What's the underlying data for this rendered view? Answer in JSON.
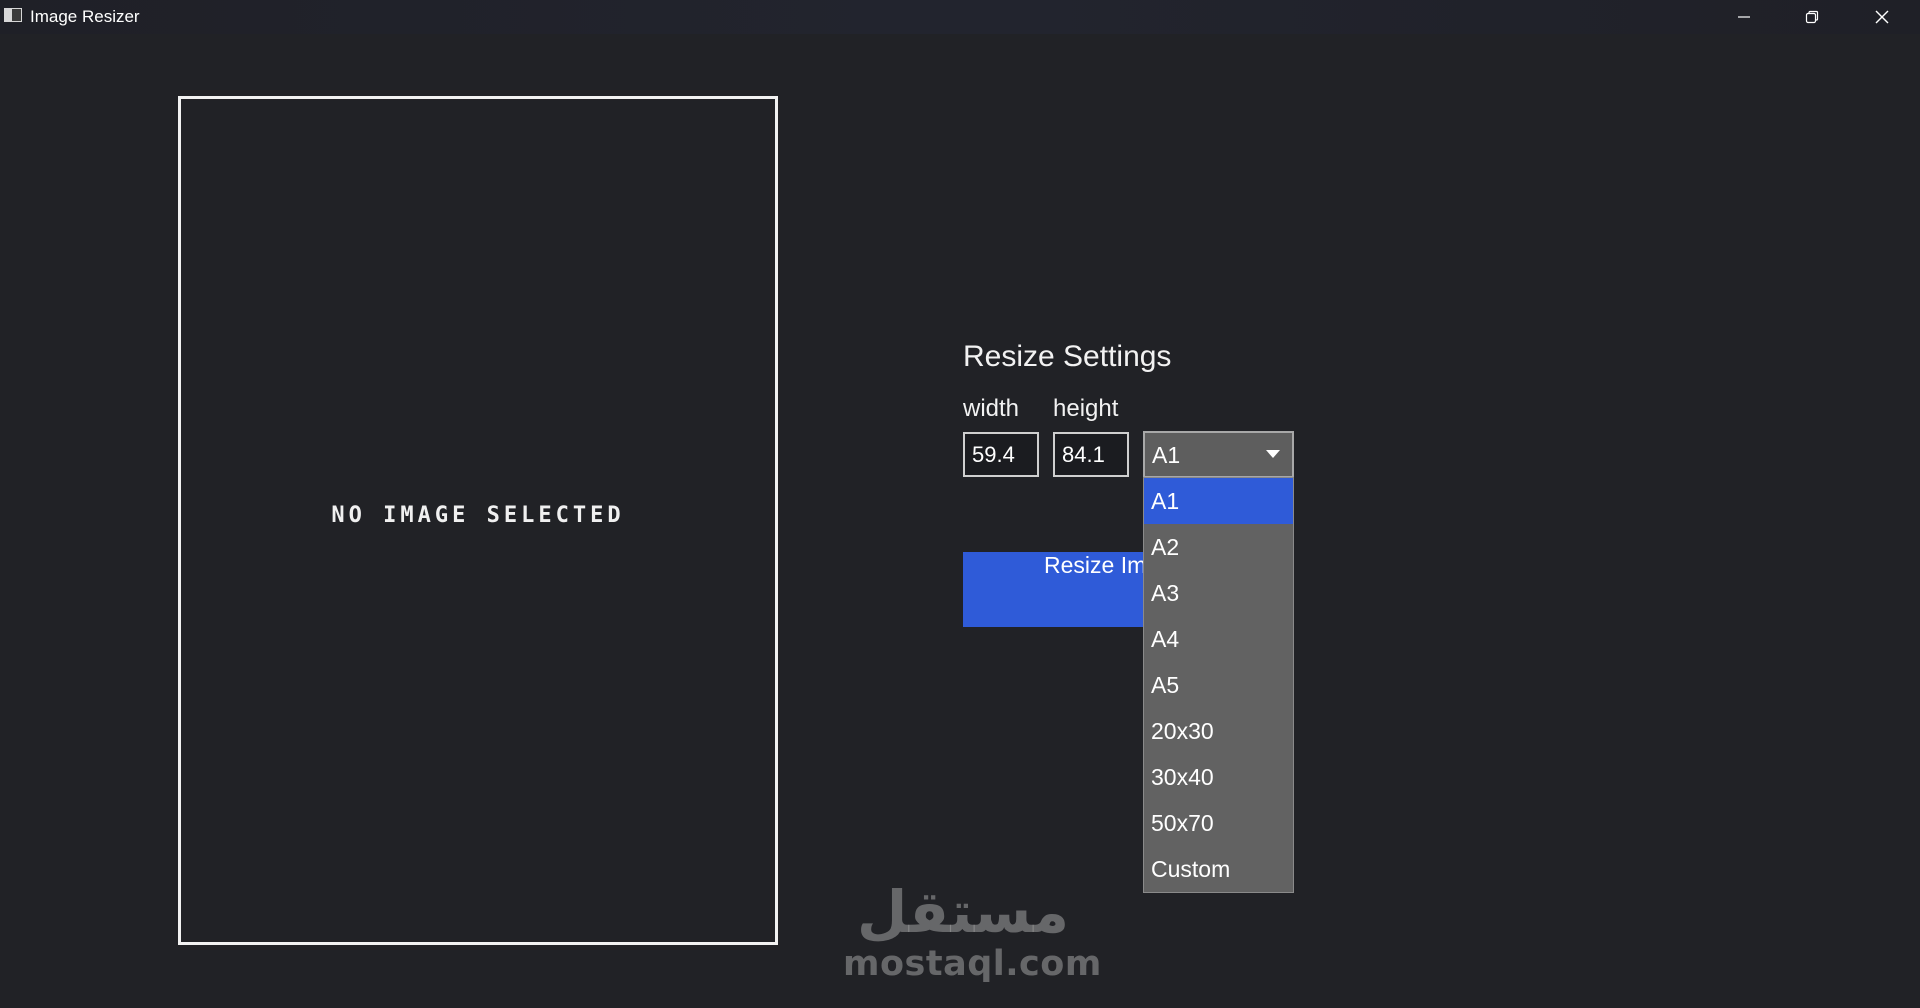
{
  "window": {
    "title": "Image Resizer",
    "icon": "app-window-icon",
    "controls": [
      "minimize-icon",
      "restore-icon",
      "close-icon"
    ]
  },
  "preview": {
    "placeholder": "NO IMAGE SELECTED"
  },
  "settings": {
    "title": "Resize Settings",
    "width_label": "width",
    "height_label": "height",
    "width_value": "59.4",
    "height_value": "84.1",
    "size_select": {
      "selected": "A1",
      "options": [
        "A1",
        "A2",
        "A3",
        "A4",
        "A5",
        "20x30",
        "30x40",
        "50x70",
        "Custom"
      ],
      "highlighted_index": 0
    },
    "resize_button_label": "Resize Image"
  },
  "watermark": {
    "arabic": "مستقل",
    "latin": "mostaql.com"
  },
  "colors": {
    "background": "#212226",
    "accent": "#2f5bd8",
    "dropdown_bg": "#626262",
    "text": "#f2f2f2"
  }
}
